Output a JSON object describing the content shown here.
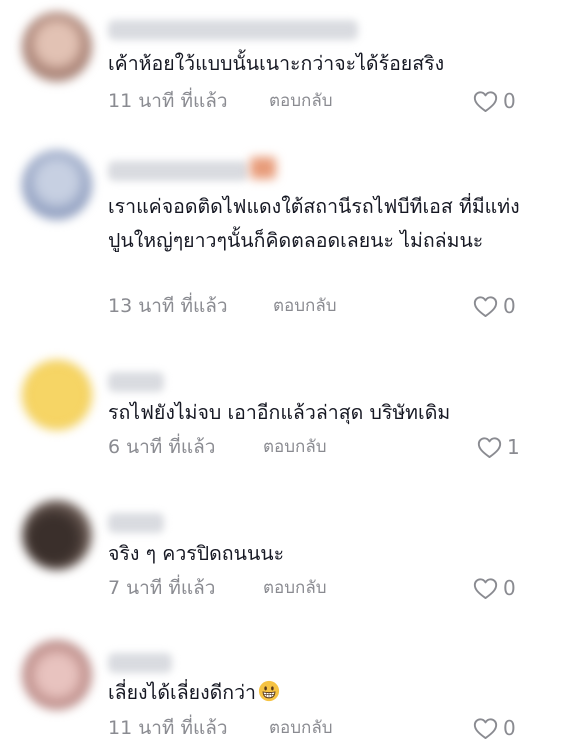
{
  "comments": [
    {
      "text": "เค้าห้อยใว้แบบนั้นเนาะกว่าจะได้ร้อยสริง",
      "time": "11 นาที ที่แล้ว",
      "reply": "ตอบกลับ",
      "likes": "0",
      "avatar_color": "#c9a89a"
    },
    {
      "text": "เราแค่จอดติดไฟแดงใต้สถานีรถไฟบีทีเอส ที่มีแท่งปูนใหญ่ๆยาวๆนั้นก็คิดตลอดเลยนะ ไม่ถล่มนะ",
      "time": "13 นาที ที่แล้ว",
      "reply": "ตอบกลับ",
      "likes": "0",
      "avatar_color": "#aab6cf"
    },
    {
      "text": "รถไฟยังไม่จบ เอาอีกแล้วล่าสุด บริษัทเดิม",
      "time": "6 นาที ที่แล้ว",
      "reply": "ตอบกลับ",
      "likes": "1",
      "avatar_color": "#f2cc55"
    },
    {
      "text": "จริง ๆ ควรปิดถนนนะ",
      "time": "7 นาที ที่แล้ว",
      "reply": "ตอบกลับ",
      "likes": "0",
      "avatar_color": "#5a4a44"
    },
    {
      "text": "เลี่ยงได้เลี่ยงดีกว่า",
      "time": "11 นาที ที่แล้ว",
      "reply": "ตอบกลับ",
      "likes": "0",
      "avatar_color": "#d4aaa6",
      "emoji": "grinning-face-icon"
    }
  ]
}
